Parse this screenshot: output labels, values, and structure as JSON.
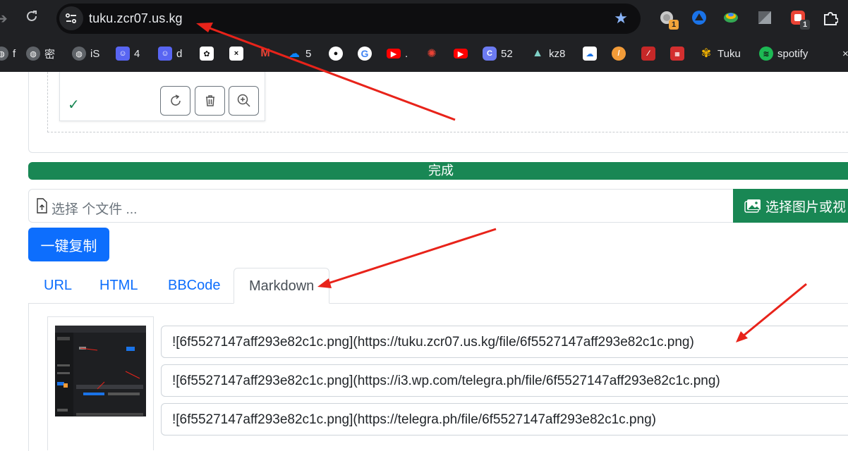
{
  "browser": {
    "url": "tuku.zcr07.us.kg",
    "extension_badges": [
      "1",
      "1"
    ],
    "bookmarks": [
      {
        "label": "f",
        "icon": "globe-icon"
      },
      {
        "label": "密",
        "icon": "globe-icon"
      },
      {
        "label": "iS",
        "icon": "globe-icon"
      },
      {
        "label": "4",
        "icon": "ghost-icon"
      },
      {
        "label": "d",
        "icon": "ghost-icon"
      },
      {
        "label": "",
        "icon": "openai-icon"
      },
      {
        "label": "",
        "icon": "fish-icon"
      },
      {
        "label": "",
        "icon": "gmail-icon"
      },
      {
        "label": "5",
        "icon": "onedrive-icon"
      },
      {
        "label": "",
        "icon": "github-icon"
      },
      {
        "label": "",
        "icon": "google-icon"
      },
      {
        "label": ".",
        "icon": "youtube-icon"
      },
      {
        "label": "",
        "icon": "octopus-icon"
      },
      {
        "label": "",
        "icon": "youtube-icon"
      },
      {
        "label": "52",
        "icon": "c-icon"
      },
      {
        "label": "kz8",
        "icon": "mountain-icon"
      },
      {
        "label": "",
        "icon": "cloud-icon"
      },
      {
        "label": "",
        "icon": "orange-icon"
      },
      {
        "label": "",
        "icon": "red-square-icon"
      },
      {
        "label": "",
        "icon": "seal-icon"
      },
      {
        "label": "Tuku",
        "icon": "flower-icon"
      },
      {
        "label": "spotify",
        "icon": "spotify-icon"
      }
    ]
  },
  "upload": {
    "progress_label": "完成",
    "file_placeholder": "选择 个文件 ...",
    "pick_button_label": "选择图片或视"
  },
  "copy_all_label": "一键复制",
  "tabs": [
    {
      "label": "URL",
      "active": false
    },
    {
      "label": "HTML",
      "active": false
    },
    {
      "label": "BBCode",
      "active": false
    },
    {
      "label": "Markdown",
      "active": true
    }
  ],
  "links": [
    "![6f5527147aff293e82c1c.png](https://tuku.zcr07.us.kg/file/6f5527147aff293e82c1c.png)",
    "![6f5527147aff293e82c1c.png](https://i3.wp.com/telegra.ph/file/6f5527147aff293e82c1c.png)",
    "![6f5527147aff293e82c1c.png](https://telegra.ph/file/6f5527147aff293e82c1c.png)"
  ],
  "colors": {
    "success": "#198754",
    "primary": "#0d6efd",
    "annotation_arrow": "#e8231a"
  }
}
